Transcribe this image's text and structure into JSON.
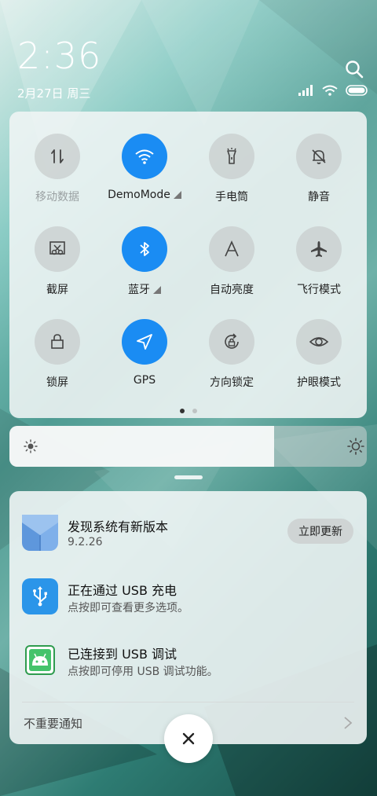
{
  "status": {
    "time": "2:36",
    "date": "2月27日 周三"
  },
  "quick_settings": {
    "tiles": [
      {
        "label": "移动数据",
        "icon": "mobile-data-icon",
        "active": false
      },
      {
        "label": "DemoMode",
        "icon": "wifi-icon",
        "active": true
      },
      {
        "label": "手电筒",
        "icon": "flashlight-icon",
        "active": false
      },
      {
        "label": "静音",
        "icon": "mute-bell-icon",
        "active": false
      },
      {
        "label": "截屏",
        "icon": "screenshot-icon",
        "active": false
      },
      {
        "label": "蓝牙",
        "icon": "bluetooth-icon",
        "active": true
      },
      {
        "label": "自动亮度",
        "icon": "auto-brightness-icon",
        "active": false
      },
      {
        "label": "飞行模式",
        "icon": "airplane-icon",
        "active": false
      },
      {
        "label": "锁屏",
        "icon": "lock-icon",
        "active": false
      },
      {
        "label": "GPS",
        "icon": "location-arrow-icon",
        "active": true
      },
      {
        "label": "方向锁定",
        "icon": "rotation-lock-icon",
        "active": false
      },
      {
        "label": "护眼模式",
        "icon": "eye-icon",
        "active": false
      }
    ],
    "page_count": 2,
    "current_page": 1
  },
  "brightness": {
    "level": 0.74
  },
  "notifications": [
    {
      "title": "发现系统有新版本",
      "subtitle": "9.2.26",
      "icon": "system-update-icon",
      "action": "立即更新"
    },
    {
      "title": "正在通过 USB 充电",
      "subtitle": "点按即可查看更多选项。",
      "icon": "usb-icon"
    },
    {
      "title": "已连接到 USB 调试",
      "subtitle": "点按即可停用 USB 调试功能。",
      "icon": "android-debug-icon"
    }
  ],
  "footer": {
    "unimportant_label": "不重要通知"
  },
  "colors": {
    "accent": "#1a8cf3",
    "usb_icon_bg": "#2b95e9",
    "debug_icon_bg": "#44c36b"
  }
}
